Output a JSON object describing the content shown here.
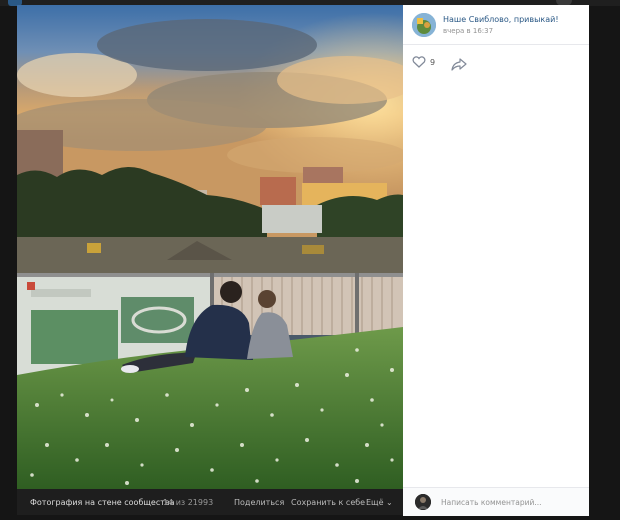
{
  "post": {
    "group_name": "Наше Свиблово, привыкай!",
    "time": "вчера в 16:37",
    "likes": "9"
  },
  "photo_bar": {
    "title": "Фотография на стене сообщества",
    "counter": "14 из 21993",
    "share": "Поделиться",
    "save": "Сохранить к себе",
    "more": "Ещё ⌄"
  },
  "comment": {
    "placeholder": "Написать комментарий..."
  },
  "icons": {
    "like": "heart-icon",
    "share": "share-arrow-icon"
  },
  "colors": {
    "link": "#2a5885",
    "muted": "#939393"
  }
}
